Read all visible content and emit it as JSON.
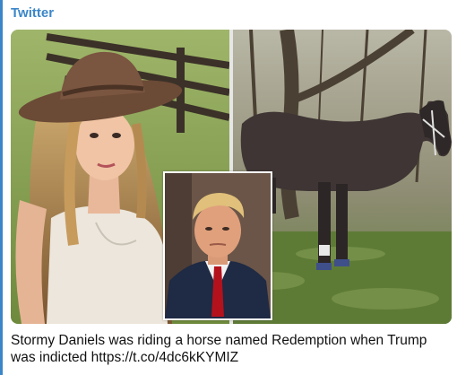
{
  "header": {
    "source_label": "Twitter"
  },
  "colors": {
    "accent": "#3a86c8",
    "text": "#111111"
  },
  "tweet": {
    "text": "Stormy Daniels was riding a horse named Redemption when Trump was indicted",
    "link": "https://t.co/4dc6kKYMIZ"
  },
  "media": {
    "images": [
      {
        "name": "woman-cowboy-hat-photo"
      },
      {
        "name": "horse-photo"
      },
      {
        "name": "man-portrait-inset-photo"
      }
    ]
  }
}
